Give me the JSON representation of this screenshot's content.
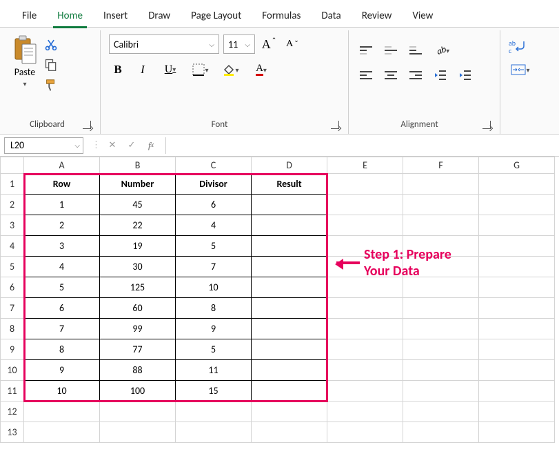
{
  "menu": {
    "items": [
      "File",
      "Home",
      "Insert",
      "Draw",
      "Page Layout",
      "Formulas",
      "Data",
      "Review",
      "View"
    ],
    "active": 1
  },
  "clipboard": {
    "paste_label": "Paste",
    "group_label": "Clipboard"
  },
  "font": {
    "name": "Calibri",
    "size": "11",
    "group_label": "Font",
    "bold": "B",
    "italic": "I",
    "underline": "U"
  },
  "alignment": {
    "group_label": "Alignment"
  },
  "name_box": "L20",
  "formula_value": "",
  "columns": [
    "A",
    "B",
    "C",
    "D",
    "E",
    "F",
    "G"
  ],
  "rows": [
    1,
    2,
    3,
    4,
    5,
    6,
    7,
    8,
    9,
    10,
    11,
    12,
    13
  ],
  "headers": [
    "Row",
    "Number",
    "Divisor",
    "Result"
  ],
  "data": [
    [
      "1",
      "45",
      "6",
      ""
    ],
    [
      "2",
      "22",
      "4",
      ""
    ],
    [
      "3",
      "19",
      "5",
      ""
    ],
    [
      "4",
      "30",
      "7",
      ""
    ],
    [
      "5",
      "125",
      "10",
      ""
    ],
    [
      "6",
      "60",
      "8",
      ""
    ],
    [
      "7",
      "99",
      "9",
      ""
    ],
    [
      "8",
      "77",
      "5",
      ""
    ],
    [
      "9",
      "88",
      "11",
      ""
    ],
    [
      "10",
      "100",
      "15",
      ""
    ]
  ],
  "annotation": {
    "text1": "Step 1: Prepare",
    "text2": "Your Data"
  }
}
